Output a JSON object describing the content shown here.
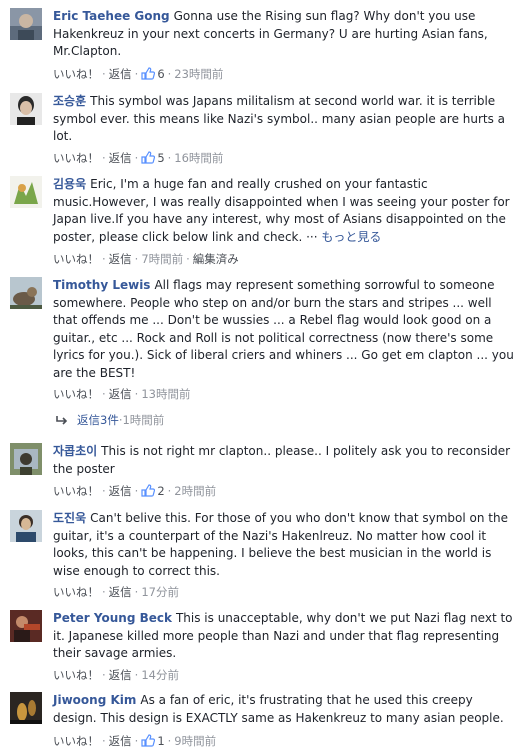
{
  "labels": {
    "like": "いいね！",
    "reply": "返信",
    "edit_history": "編集済み",
    "see_more": "もっと見る",
    "sep": "·"
  },
  "comments": [
    {
      "author": "Eric Taehee Gong",
      "text": "Gonna use the Rising sun flag? Why don't you use Hakenkreuz in your next concerts in Germany? U are hurting Asian fans, Mr.Clapton.",
      "likes": "6",
      "time": "23時間前"
    },
    {
      "author": "조승훈",
      "text": "This symbol was Japans militalism at second world war. it is terrible symbol ever. this means like Nazi's symbol.. many asian people are hurts a lot.",
      "likes": "5",
      "time": "16時間前"
    },
    {
      "author": "김용욱",
      "text": "Eric, I'm a huge fan and really crushed on your fantastic music.However, I was really disappointed when I was seeing your poster for Japan live.If you have any interest, why most of Asians disappointed on the poster, please click below link and check. ···",
      "time": "7時間前"
    },
    {
      "author": "Timothy Lewis",
      "text": "All flags may represent something sorrowful to someone somewhere. People who step on and/or burn the stars and stripes ... well that offends me ... Don't be wussies ... a Rebel flag would look good on a guitar., etc ... Rock and Roll is not political correctness (now there's some lyrics for you.). Sick of liberal criers and whiners ... Go get em clapton ... you are the BEST!",
      "time": "13時間前"
    },
    {
      "author": "자콥초이",
      "text": "This is not right mr clapton.. please.. I politely ask you to reconsider the poster",
      "likes": "2",
      "time": "2時間前"
    },
    {
      "author": "도진욱",
      "text": "Can't belive this. For those of you who don't know that symbol on the guitar, it's a counterpart of the Nazi's Hakenlreuz. No matter how cool it looks, this can't be happening. I believe the best musician in the world is wise enough to correct this.",
      "time": "17分前"
    },
    {
      "author": "Peter Young Beck",
      "text": "This is unacceptable, why don't we put Nazi flag next to it. Japanese killed more people than Nazi and under that flag representing their savage armies.",
      "time": "14分前"
    },
    {
      "author": "Jiwoong Kim",
      "text": "As a fan of eric, it's frustrating that he used this creepy design. This design is EXACTLY same as Hakenkreuz to many asian people.",
      "likes": "1",
      "time": "9時間前"
    }
  ],
  "replies": {
    "label": "返信3件",
    "time": "1時間前"
  },
  "colors": {
    "link": "#365899",
    "text": "#1d2129",
    "meta": "#90949c",
    "action": "#4b4f56"
  }
}
